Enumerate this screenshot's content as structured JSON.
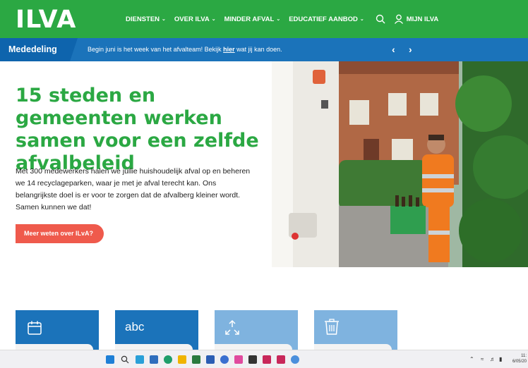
{
  "header": {
    "logo": "ILVA",
    "nav": [
      {
        "label": "DIENSTEN"
      },
      {
        "label": "OVER ILVA"
      },
      {
        "label": "MINDER AFVAL"
      },
      {
        "label": "EDUCATIEF AANBOD"
      }
    ],
    "account_label": "MIJN ILVA"
  },
  "announcement": {
    "label": "Mededeling",
    "text_before": "Begin juni is het week van het afvalteam! Bekijk ",
    "link": "hier",
    "text_after": " wat jij kan doen."
  },
  "hero": {
    "title": "15 steden en gemeenten werken samen voor een zelfde afvalbeleid",
    "body": "Met 300 medewerkers halen we jullie huishoudelijk afval op en beheren we 14 recyclageparken, waar je met je afval terecht kan. Ons belangrijkste doel is er voor te zorgen dat de afvalberg kleiner wordt. Samen kunnen we dat!",
    "cta": "Meer weten over ILvA?"
  },
  "cards": [
    {
      "icon": "calendar-icon"
    },
    {
      "icon": "abc-icon",
      "label": "abc"
    },
    {
      "icon": "arrows-icon"
    },
    {
      "icon": "trash-icon"
    }
  ],
  "taskbar": {
    "clock_time": "11:",
    "clock_date": "6/05/20"
  },
  "colors": {
    "green": "#2ba843",
    "blue": "#1b73ba",
    "dark_blue": "#0e64ad",
    "light_blue": "#7fb3df",
    "cta_red": "#ef5a4c"
  }
}
